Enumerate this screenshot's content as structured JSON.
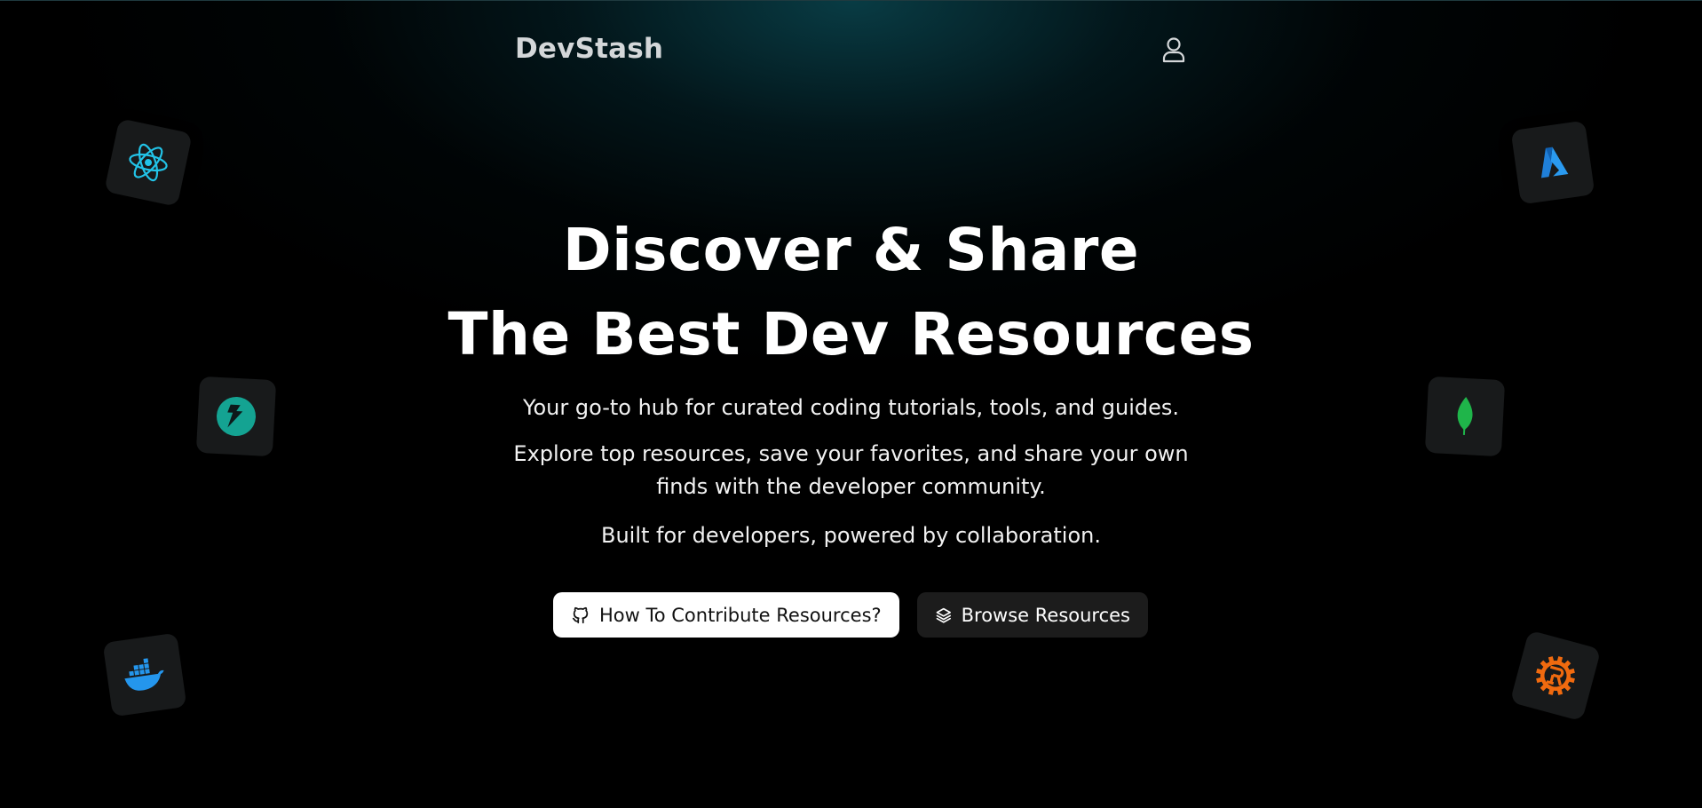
{
  "header": {
    "brand": "DevStash",
    "user_icon": "user-icon"
  },
  "hero": {
    "headline_line1": "Discover & Share",
    "headline_line2": "The Best Dev Resources",
    "subtitle_1": "Your go-to hub for curated coding tutorials, tools, and guides.",
    "subtitle_2_line1": "Explore top resources, save your favorites, and share your own",
    "subtitle_2_line2": "finds with the developer community.",
    "subtitle_3": "Built for developers, powered by collaboration."
  },
  "actions": {
    "contribute_label": "How To Contribute Resources?",
    "contribute_icon": "github-icon",
    "browse_label": "Browse Resources",
    "browse_icon": "layers-icon"
  },
  "floating_tiles": [
    {
      "name": "react-icon",
      "color": "#22c4e8"
    },
    {
      "name": "azure-icon",
      "color": "#1f7fd8"
    },
    {
      "name": "fastify-icon",
      "color": "#14a392"
    },
    {
      "name": "mongodb-icon",
      "color": "#1fb54a"
    },
    {
      "name": "docker-icon",
      "color": "#2496ed"
    },
    {
      "name": "rust-icon",
      "color": "#f06a0f"
    }
  ],
  "colors": {
    "background": "#000000",
    "glow": "#0a4650",
    "primary_button_bg": "#ffffff",
    "secondary_button_bg": "#1c1c1c"
  }
}
